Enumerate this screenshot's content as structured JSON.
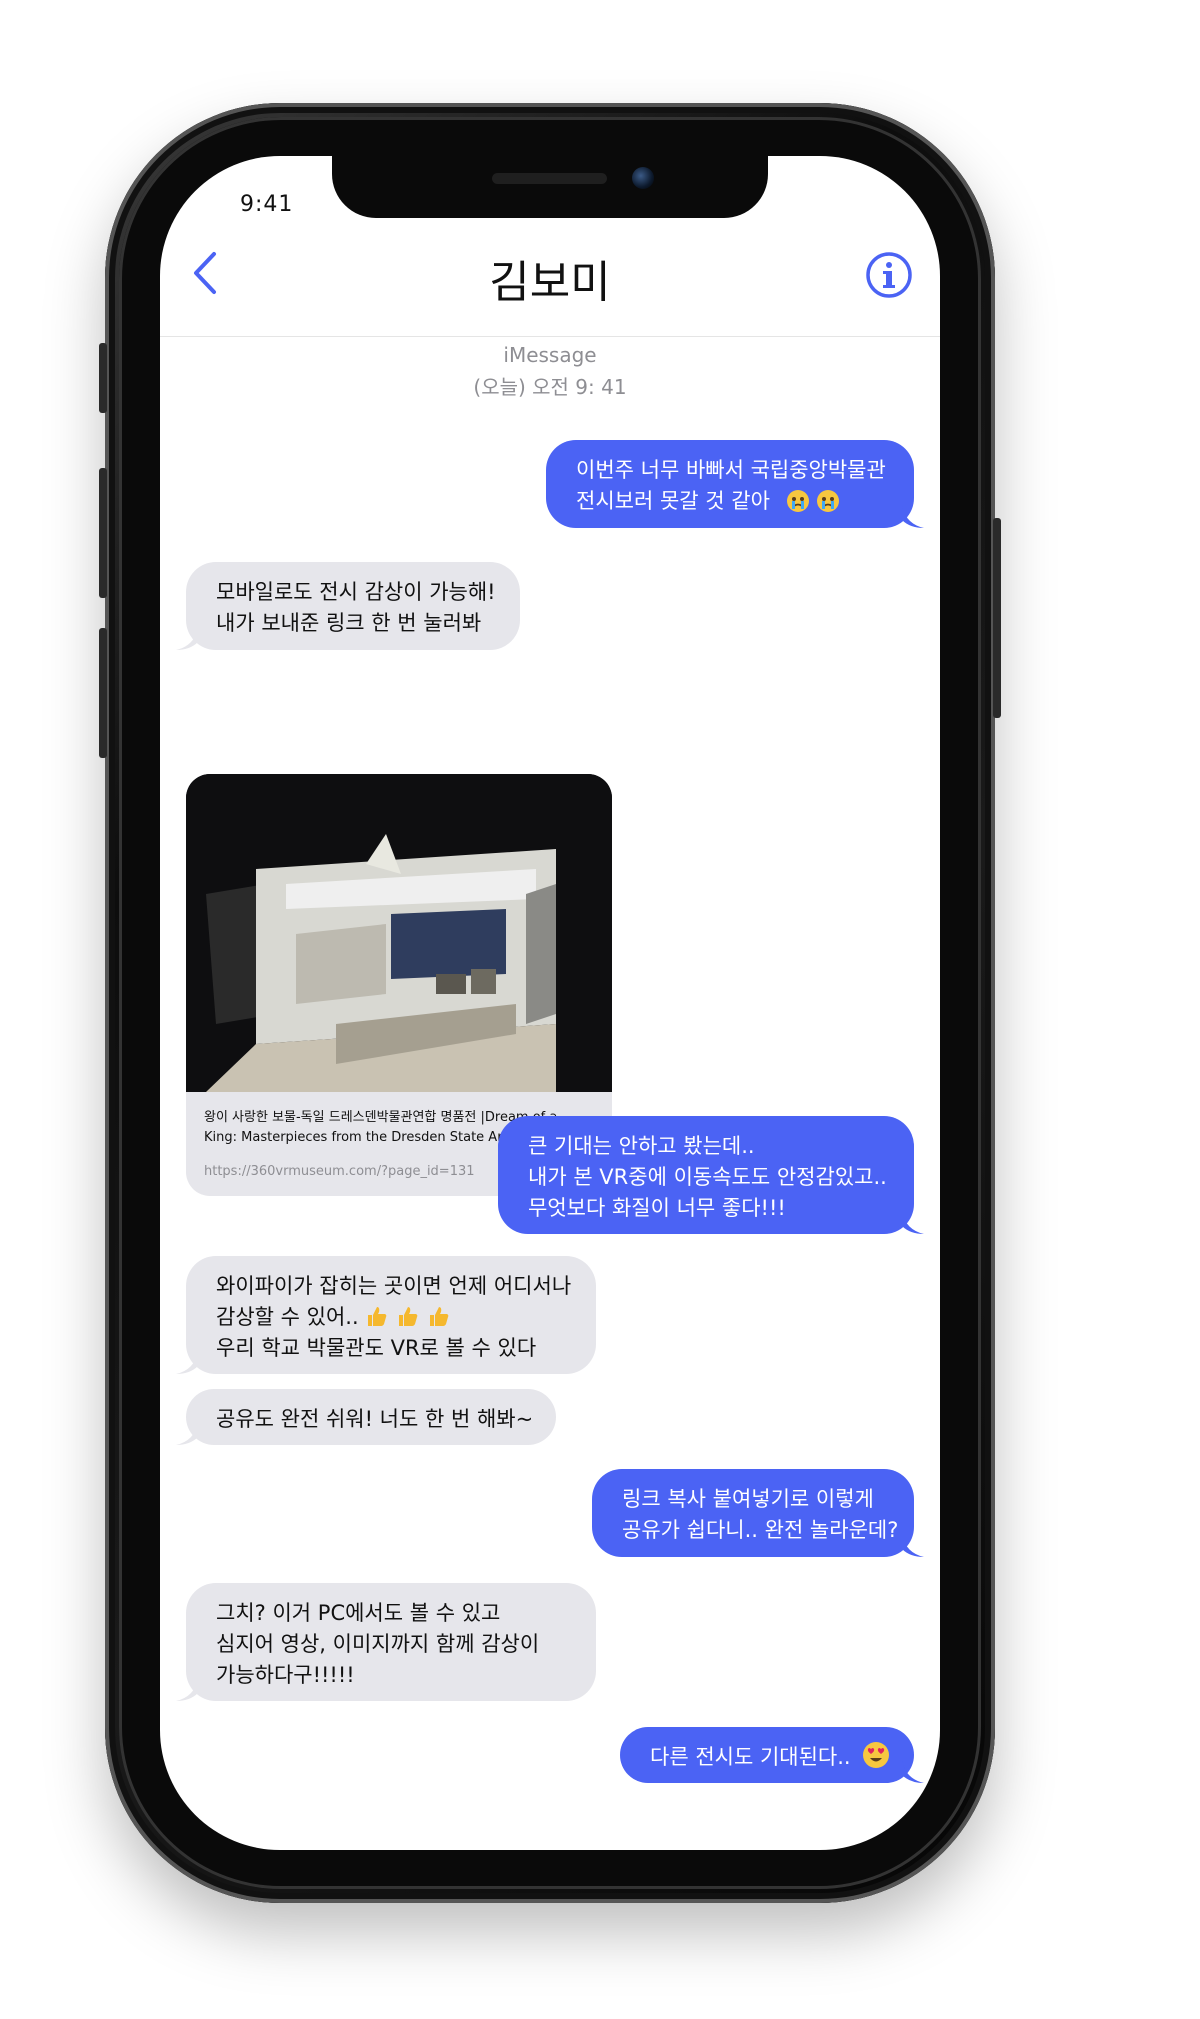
{
  "status_bar": {
    "time": "9:41"
  },
  "header": {
    "contact_name": "김보미"
  },
  "thread": {
    "service": "iMessage",
    "timestamp": "(오늘) 오전 9: 41"
  },
  "messages": [
    {
      "lines": [
        "이번주 너무 바빠서 국립중앙박물관",
        "전시보러 못갈 것 같아"
      ],
      "emoji": [
        "crying-face",
        "crying-face"
      ]
    },
    {
      "lines": [
        "모바일로도 전시 감상이 가능해!",
        "내가 보내준 링크 한 번 눌러봐"
      ]
    },
    {
      "lines": [
        "큰 기대는 안하고 봤는데..",
        "내가 본 VR중에 이동속도도 안정감있고..",
        "무엇보다 화질이 너무 좋다!!!"
      ]
    },
    {
      "lines": [
        "와이파이가 잡히는 곳이면 언제 어디서나",
        "감상할 수 있어..",
        "우리 학교 박물관도 VR로 볼 수 있다"
      ],
      "emoji": [
        "thumbs-up",
        "thumbs-up",
        "thumbs-up"
      ]
    },
    {
      "lines": [
        "공유도 완전 쉬워! 너도 한 번 해봐~"
      ]
    },
    {
      "lines": [
        "링크 복사 붙여넣기로 이렇게",
        "공유가 쉽다니.. 완전 놀라운데?"
      ]
    },
    {
      "lines": [
        "그치? 이거 PC에서도 볼 수 있고",
        "심지어 영상, 이미지까지 함께 감상이",
        "가능하다구!!!!!"
      ]
    },
    {
      "lines": [
        "다른 전시도 기대된다.."
      ],
      "emoji": [
        "heart-eyes-face"
      ]
    }
  ],
  "link_preview": {
    "title_line1": "왕이 사랑한 보물-독일 드레스덴박물관연합 명품전 |Dream of a",
    "title_line2": "King: Masterpieces from the Dresden State Art Collections",
    "url": "https://360vrmuseum.com/?page_id=131"
  },
  "colors": {
    "outgoing_bubble": "#4b63f4",
    "incoming_bubble": "#e6e6eb",
    "accent": "#4b63f4"
  }
}
